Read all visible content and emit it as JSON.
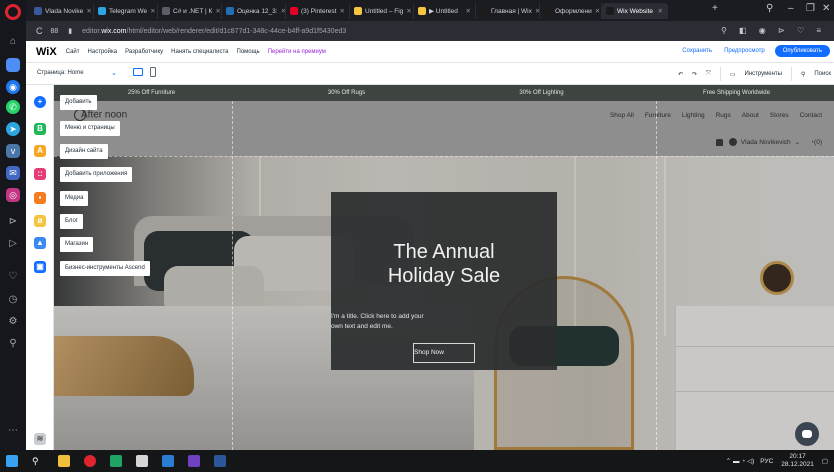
{
  "browser": {
    "tabs": [
      {
        "label": "Vlada Novike",
        "color": "#3b5998"
      },
      {
        "label": "Telegram We",
        "color": "#2ca5e0"
      },
      {
        "label": "C# и .NET | К",
        "color": "#5b5e66"
      },
      {
        "label": "Оценка 12_3:",
        "color": "#1f6fb2"
      },
      {
        "label": "(3) Pinterest",
        "color": "#e60023"
      },
      {
        "label": "Untitled – Fig",
        "color": "#f5c542"
      },
      {
        "label": "▶ Untitled",
        "color": "#f5c542"
      },
      {
        "label": "Главная | Wix",
        "color": "#1b1b1b"
      },
      {
        "label": "Оформлени",
        "color": "#1b1b1b"
      },
      {
        "label": "Wix Website",
        "color": "#1b1b1b"
      }
    ],
    "new_tab": "+",
    "url_prefix": "editor.",
    "url_domain": "wix.com",
    "url_path": "/html/editor/web/renderer/edit/d1c877d1-348c-44ce-b4ff-a9d1f5430ed3"
  },
  "wix_topbar": {
    "logo": "WiX",
    "menu": [
      "Сайт",
      "Настройка",
      "Разработчику",
      "Нанять специалиста",
      "Помощь"
    ],
    "premium": "Перейти на премиум",
    "save": "Сохранить",
    "preview": "Предпросмотр",
    "publish": "Опубликовать"
  },
  "wix_secondbar": {
    "page": "Страница: Home",
    "tools": "Инструменты",
    "search": "Поиск"
  },
  "add_menu": [
    "Добавить",
    "Меню и страницы",
    "Дизайн сайта",
    "Добавить приложения",
    "Медиа",
    "Блог",
    "Магазин",
    "Бизнес-инструменты Ascend"
  ],
  "site": {
    "promos": [
      "25% Off Furniture",
      "30% Off Rugs",
      "30% Off Lighting",
      "Free Shipping Worldwide"
    ],
    "logo": "After noon",
    "nav": [
      "Shop All",
      "Furniture",
      "Lighting",
      "Rugs",
      "About",
      "Stores",
      "Contact"
    ],
    "user": "Vlada Novikevich",
    "cart": "(0)",
    "hero_title": "The Annual Holiday Sale",
    "hero_sub_1": "I'm a title. Click here to add your",
    "hero_sub_2": "own text and edit me.",
    "hero_button": "Shop Now"
  },
  "taskbar": {
    "lang": "РУС",
    "time": "20:17",
    "date": "28.12.2021"
  },
  "colors": {
    "wix_blue": "#116dff",
    "premium_purple": "#9a27d5",
    "promo_bg": "#3e4541"
  }
}
